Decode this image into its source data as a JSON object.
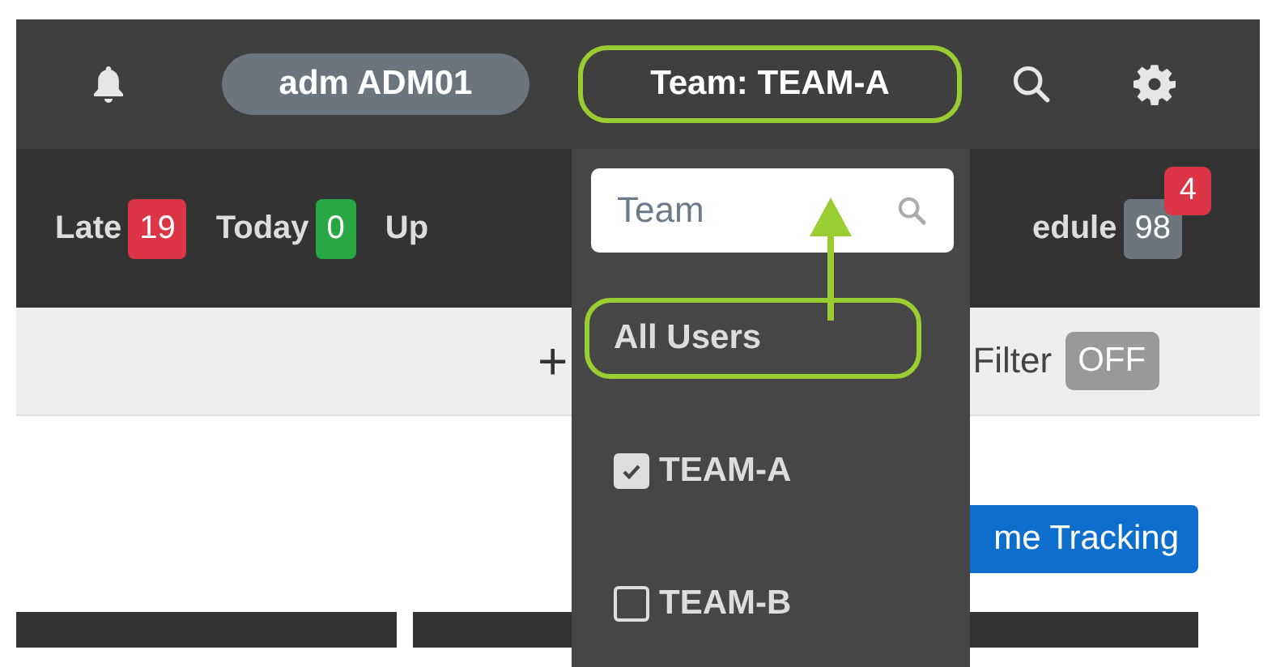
{
  "header": {
    "user": "adm ADM01",
    "team_button": {
      "label": "Team: TEAM-A",
      "highlighted": true
    }
  },
  "counters": [
    {
      "label": "Late",
      "count": "19",
      "color": "#dc3545"
    },
    {
      "label": "Today",
      "count": "0",
      "color": "#28a745"
    },
    {
      "label": "Up"
    }
  ],
  "schedule": {
    "label": "edule",
    "count": "98",
    "badge": "4"
  },
  "toolbar": {
    "add": "+",
    "filter_label": "Filter",
    "filter_state": "OFF"
  },
  "time_tracking_button": "me Tracking",
  "team_dropdown": {
    "search_placeholder": "Team",
    "items": [
      {
        "label": "All Users",
        "kind": "option",
        "highlighted": true
      },
      {
        "label": "TEAM-A",
        "kind": "checkbox",
        "checked": true
      },
      {
        "label": "TEAM-B",
        "kind": "checkbox",
        "checked": false
      }
    ]
  }
}
